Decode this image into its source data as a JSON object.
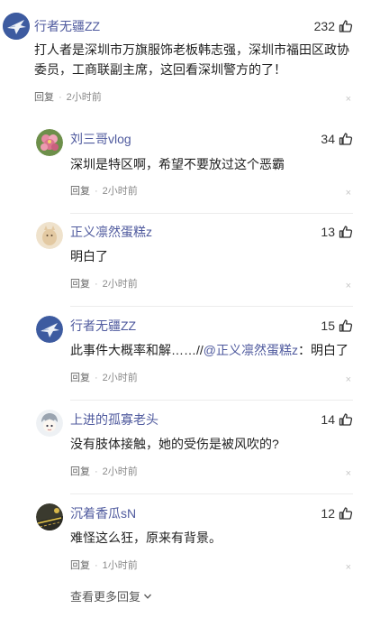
{
  "comments": [
    {
      "username": "行者无疆ZZ",
      "likes": "232",
      "text": "打人者是深圳市万旗服饰老板韩志强，深圳市福田区政协委员，工商联副主席，这回看深圳警方的了！",
      "reply_label": "回复",
      "time": "2小时前",
      "avatar": "fighter-jet-avatar"
    },
    {
      "username": "刘三哥vlog",
      "likes": "34",
      "text": "深圳是特区啊，希望不要放过这个恶霸",
      "reply_label": "回复",
      "time": "2小时前",
      "avatar": "flower-avatar"
    },
    {
      "username": "正义凛然蛋糕z",
      "likes": "13",
      "text": "明白了",
      "reply_label": "回复",
      "time": "2小时前",
      "avatar": "default-avatar"
    },
    {
      "username": "行者无疆ZZ",
      "likes": "15",
      "text_prefix": "此事件大概率和解……//",
      "mention": "@正义凛然蛋糕z",
      "text_suffix": "：明白了",
      "reply_label": "回复",
      "time": "2小时前",
      "avatar": "fighter-jet-avatar"
    },
    {
      "username": "上进的孤寡老头",
      "likes": "14",
      "text": "没有肢体接触，她的受伤是被风吹的?",
      "reply_label": "回复",
      "time": "2小时前",
      "avatar": "anime-avatar"
    },
    {
      "username": "沉着香瓜sN",
      "likes": "12",
      "text": "难怪这么狂，原来有背景。",
      "reply_label": "回复",
      "time": "1小时前",
      "avatar": "road-avatar"
    }
  ],
  "dismiss_glyph": "×",
  "meta_separator": "·",
  "more_replies_label": "查看更多回复",
  "colors": {
    "username": "#4f5a9e",
    "meta": "#8a8a8a",
    "divider": "#ececec"
  }
}
